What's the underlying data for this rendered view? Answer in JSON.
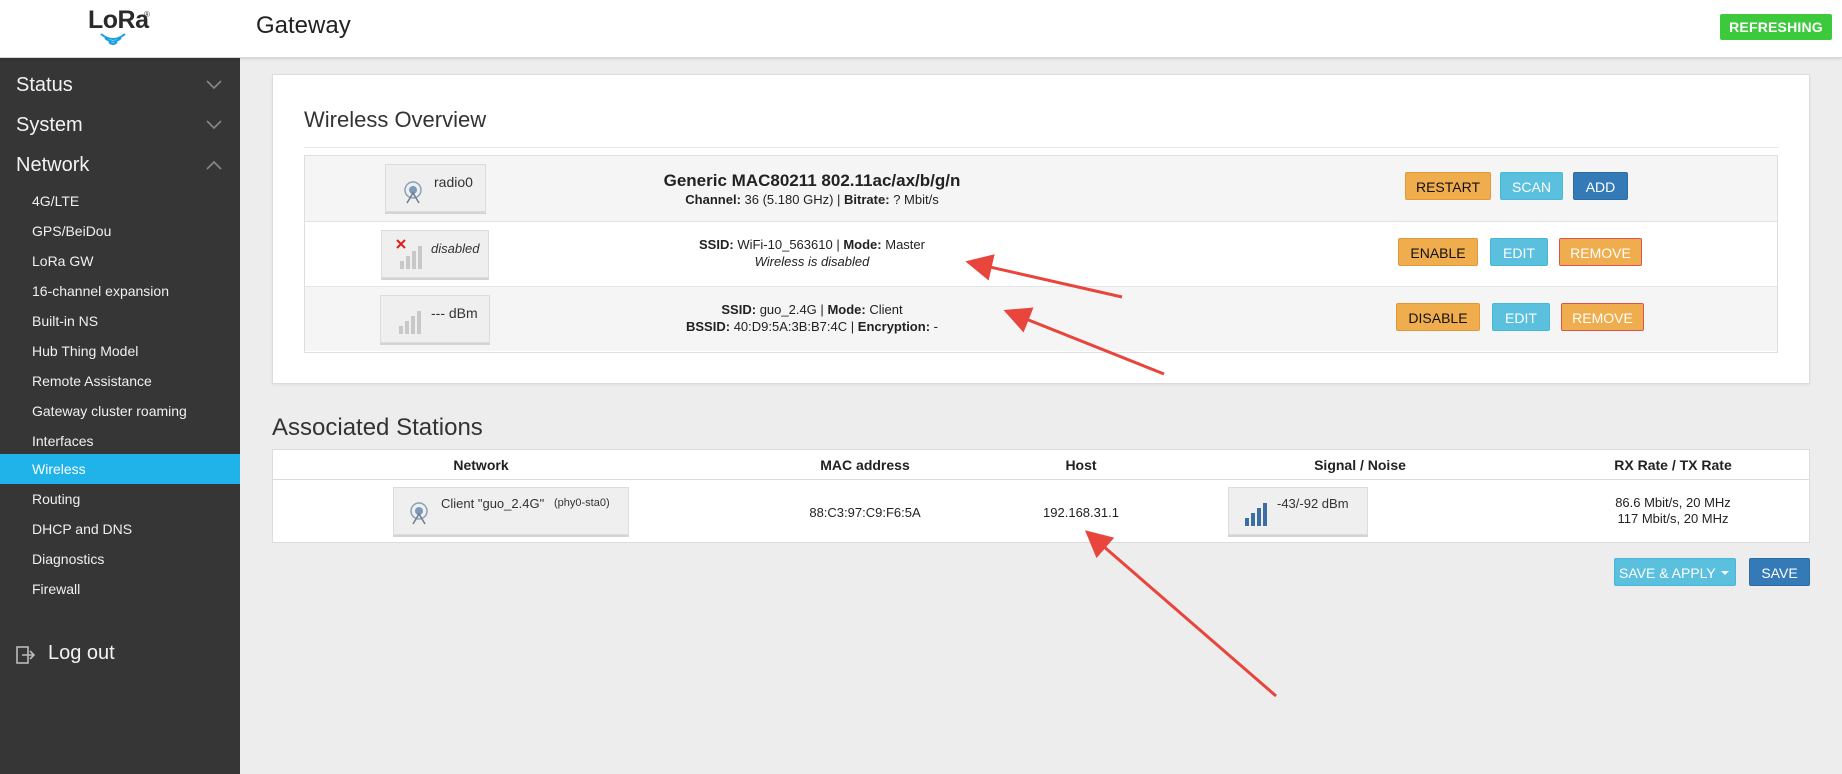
{
  "header": {
    "logo_text": "LoRa",
    "logo_reg": "®",
    "title": "Gateway",
    "status_badge": "REFRESHING"
  },
  "sidebar": {
    "sections": [
      {
        "label": "Status",
        "icon": "chevron-down-icon"
      },
      {
        "label": "System",
        "icon": "chevron-down-icon"
      },
      {
        "label": "Network",
        "icon": "chevron-up-icon"
      }
    ],
    "items": [
      {
        "label": "4G/LTE"
      },
      {
        "label": "GPS/BeiDou"
      },
      {
        "label": "LoRa GW"
      },
      {
        "label": "16-channel expansion"
      },
      {
        "label": "Built-in NS"
      },
      {
        "label": "Hub Thing Model"
      },
      {
        "label": "Remote Assistance"
      },
      {
        "label": "Gateway cluster roaming"
      },
      {
        "label": "Interfaces"
      },
      {
        "label": "Wireless",
        "active": true
      },
      {
        "label": "Routing"
      },
      {
        "label": "DHCP and DNS"
      },
      {
        "label": "Diagnostics"
      },
      {
        "label": "Firewall"
      }
    ],
    "logout_label": "Log out"
  },
  "wireless_overview": {
    "title": "Wireless Overview",
    "radio": {
      "name": "radio0",
      "model": "Generic MAC80211 802.11ac/ax/b/g/n",
      "channel_label": "Channel:",
      "channel_value": "36 (5.180 GHz)",
      "sep": "|",
      "bitrate_label": "Bitrate:",
      "bitrate_value": "? Mbit/s",
      "buttons": {
        "restart": "RESTART",
        "scan": "SCAN",
        "add": "ADD"
      }
    },
    "networks": [
      {
        "status": "disabled",
        "ssid_label": "SSID:",
        "ssid": "WiFi-10_563610",
        "mode_label": "Mode:",
        "mode": "Master",
        "note": "Wireless is disabled",
        "buttons": {
          "toggle": "ENABLE",
          "edit": "EDIT",
          "remove": "REMOVE"
        }
      },
      {
        "status": "--- dBm",
        "ssid_label": "SSID:",
        "ssid": "guo_2.4G",
        "mode_label": "Mode:",
        "mode": "Client",
        "bssid_label": "BSSID:",
        "bssid": "40:D9:5A:3B:B7:4C",
        "encryption_label": "Encryption:",
        "encryption": "-",
        "buttons": {
          "toggle": "DISABLE",
          "edit": "EDIT",
          "remove": "REMOVE"
        }
      }
    ]
  },
  "associated_stations": {
    "title": "Associated Stations",
    "columns": [
      "Network",
      "MAC address",
      "Host",
      "Signal / Noise",
      "RX Rate / TX Rate"
    ],
    "rows": [
      {
        "network": "Client \"guo_2.4G\"",
        "network_iface": "(phy0-sta0)",
        "mac": "88:C3:97:C9:F6:5A",
        "host": "192.168.31.1",
        "signal_noise": "-43/-92 dBm",
        "rx_rate": "86.6 Mbit/s, 20 MHz",
        "tx_rate": "117 Mbit/s, 20 MHz"
      }
    ]
  },
  "actions": {
    "save_apply": "SAVE & APPLY",
    "save": "SAVE"
  },
  "colors": {
    "sidebar_bg": "#363636",
    "active_item": "#1fb3ea",
    "refresh_badge": "#3cc93c",
    "annotation_arrow": "#e8453c"
  }
}
